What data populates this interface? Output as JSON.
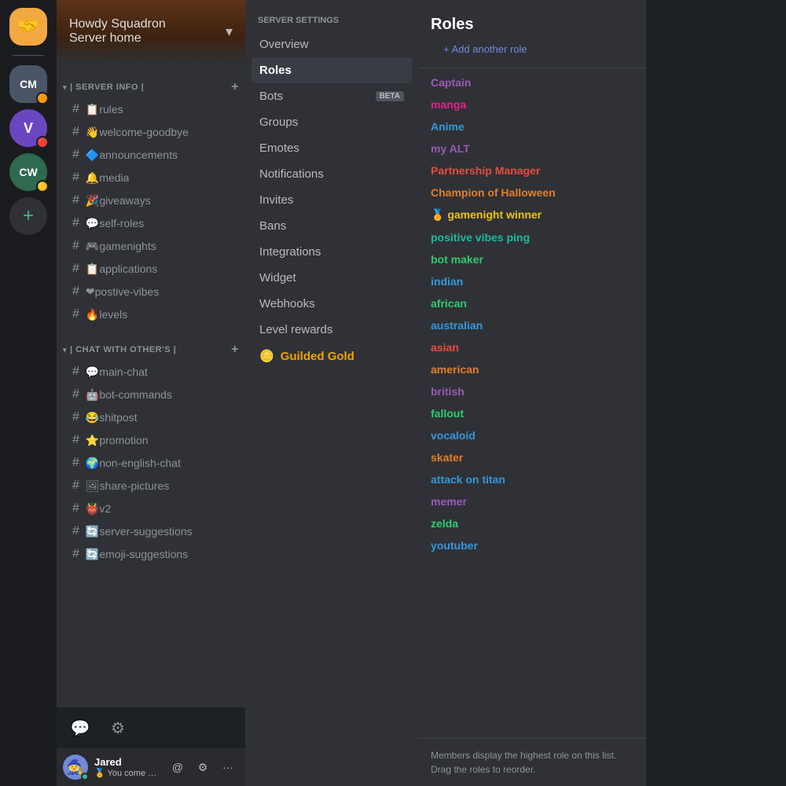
{
  "serverList": {
    "servers": [
      {
        "id": "main",
        "label": "🤝",
        "type": "emoji",
        "bg": "#f4a841",
        "shape": "rounded"
      },
      {
        "id": "cm",
        "label": "CM",
        "type": "text",
        "bg": "#4a5568",
        "badge": "🟠",
        "shape": "rounded"
      },
      {
        "id": "v",
        "label": "V",
        "type": "text",
        "bg": "#6b46c1",
        "badge": "🔴",
        "shape": "circle"
      },
      {
        "id": "cw",
        "label": "CW",
        "type": "text",
        "bg": "#2d6a4f",
        "badge": "🟡",
        "shape": "circle"
      }
    ],
    "addLabel": "+"
  },
  "serverHeader": {
    "name": "Howdy Squadron",
    "subtitle": "Server home"
  },
  "categories": [
    {
      "id": "server-info",
      "name": "| Server Info |",
      "channels": [
        {
          "id": "rules",
          "name": "📋rules",
          "emoji": "📋"
        },
        {
          "id": "welcome-goodbye",
          "name": "👋welcome-goodbye",
          "emoji": "👋"
        },
        {
          "id": "announcements",
          "name": "🔷announcements",
          "emoji": "🔷"
        },
        {
          "id": "media",
          "name": "🔔media",
          "emoji": "🔔"
        },
        {
          "id": "giveaways",
          "name": "🎉giveaways",
          "emoji": "🎉"
        },
        {
          "id": "self-roles",
          "name": "💬self-roles",
          "emoji": "💬"
        },
        {
          "id": "gamenights",
          "name": "🎮gamenights",
          "emoji": "🎮"
        },
        {
          "id": "applications",
          "name": "📋applications",
          "emoji": "📋"
        },
        {
          "id": "postive-vibes",
          "name": "❤postive-vibes",
          "emoji": "❤"
        },
        {
          "id": "levels",
          "name": "🔥levels",
          "emoji": "🔥"
        }
      ]
    },
    {
      "id": "chat-with-others",
      "name": "| Chat With other's |",
      "channels": [
        {
          "id": "main-chat",
          "name": "💬main-chat",
          "emoji": "💬"
        },
        {
          "id": "bot-commands",
          "name": "🤖bot-commands",
          "emoji": "🤖"
        },
        {
          "id": "shitpost",
          "name": "😂shitpost",
          "emoji": "😂"
        },
        {
          "id": "promotion",
          "name": "⭐promotion",
          "emoji": "⭐"
        },
        {
          "id": "non-english-chat",
          "name": "🌍non-english-chat",
          "emoji": "🌍"
        },
        {
          "id": "share-pictures",
          "name": "🖼share-pictures",
          "emoji": "🖼"
        },
        {
          "id": "v2",
          "name": "👹v2",
          "emoji": "👹"
        },
        {
          "id": "server-suggestions",
          "name": "🔄server-suggestions",
          "emoji": "🔄"
        },
        {
          "id": "emoji-suggestions",
          "name": "🔄emoji-suggestions",
          "emoji": "🔄"
        }
      ]
    }
  ],
  "user": {
    "name": "Jared",
    "status": "🏅 You come again...",
    "avatarEmoji": "🧙"
  },
  "settingsMenu": {
    "title": "Server settings",
    "items": [
      {
        "id": "overview",
        "label": "Overview",
        "active": false
      },
      {
        "id": "roles",
        "label": "Roles",
        "active": true
      },
      {
        "id": "bots",
        "label": "Bots",
        "active": false,
        "badge": "BETA"
      },
      {
        "id": "groups",
        "label": "Groups",
        "active": false
      },
      {
        "id": "emotes",
        "label": "Emotes",
        "active": false
      },
      {
        "id": "notifications",
        "label": "Notifications",
        "active": false
      },
      {
        "id": "invites",
        "label": "Invites",
        "active": false
      },
      {
        "id": "bans",
        "label": "Bans",
        "active": false
      },
      {
        "id": "integrations",
        "label": "Integrations",
        "active": false
      },
      {
        "id": "widget",
        "label": "Widget",
        "active": false
      },
      {
        "id": "webhooks",
        "label": "Webhooks",
        "active": false
      },
      {
        "id": "level-rewards",
        "label": "Level rewards",
        "active": false
      }
    ],
    "guildedGold": {
      "label": "Guilded Gold",
      "emoji": "🪙"
    }
  },
  "rolesPanel": {
    "title": "Roles",
    "addLabel": "+ Add another role",
    "roles": [
      {
        "id": "captain",
        "name": "Captain",
        "color": "#9b59b6"
      },
      {
        "id": "manga",
        "name": "manga",
        "color": "#e91e8c"
      },
      {
        "id": "anime",
        "name": "Anime",
        "color": "#3498db"
      },
      {
        "id": "my-alt",
        "name": "my ALT",
        "color": "#9b59b6"
      },
      {
        "id": "partnership-manager",
        "name": "Partnership Manager",
        "color": "#e74c3c"
      },
      {
        "id": "champion-halloween",
        "name": "Champion of Halloween",
        "color": "#e67e22"
      },
      {
        "id": "gamenight-winner",
        "name": "🏅 gamenight winner",
        "color": "#f1c40f"
      },
      {
        "id": "positive-vibes-ping",
        "name": "positive vibes ping",
        "color": "#1abc9c"
      },
      {
        "id": "bot-maker",
        "name": "bot maker",
        "color": "#2ecc71"
      },
      {
        "id": "indian",
        "name": "indian",
        "color": "#3498db"
      },
      {
        "id": "african",
        "name": "african",
        "color": "#2ecc71"
      },
      {
        "id": "australian",
        "name": "australian",
        "color": "#3498db"
      },
      {
        "id": "asian",
        "name": "asian",
        "color": "#e74c3c"
      },
      {
        "id": "american",
        "name": "american",
        "color": "#e67e22"
      },
      {
        "id": "british",
        "name": "british",
        "color": "#9b59b6"
      },
      {
        "id": "fallout",
        "name": "fallout",
        "color": "#2ecc71"
      },
      {
        "id": "vocaloid",
        "name": "vocaloid",
        "color": "#3498db"
      },
      {
        "id": "skater",
        "name": "skater",
        "color": "#e67e22"
      },
      {
        "id": "attack-on-titan",
        "name": "attack on titan",
        "color": "#3498db"
      },
      {
        "id": "memer",
        "name": "memer",
        "color": "#9b59b6"
      },
      {
        "id": "zelda",
        "name": "zelda",
        "color": "#2ecc71"
      },
      {
        "id": "youtuber",
        "name": "youtuber",
        "color": "#3498db"
      }
    ],
    "footerText": "Members display the highest role on this list. Drag the roles to reorder."
  }
}
